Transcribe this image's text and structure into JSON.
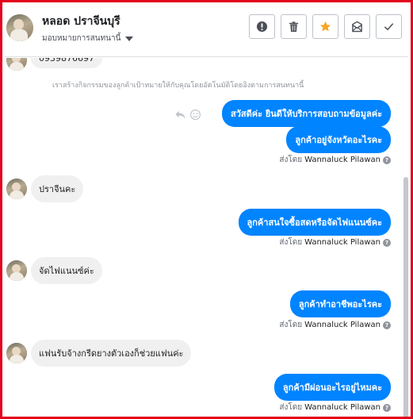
{
  "header": {
    "contact_name": "หลอด ปราจีนบุรี",
    "assign_label": "มอบหมายการสนทนานี้"
  },
  "actions": [
    {
      "name": "alert-button",
      "icon": "exclamation-icon"
    },
    {
      "name": "delete-button",
      "icon": "trash-icon"
    },
    {
      "name": "star-button",
      "icon": "star-icon"
    },
    {
      "name": "mark-unread-button",
      "icon": "envelope-icon"
    },
    {
      "name": "done-button",
      "icon": "check-icon"
    }
  ],
  "colors": {
    "accent": "#0084ff",
    "star": "#f5a623",
    "frame": "#e4001b"
  },
  "conversation": {
    "partial_phone": "0939876697",
    "system_note": "เราสร้างกิจกรรมของลูกค้าเป้าหมายให้กับคุณโดยอัตโนมัติโดยอิงตามการสนทนานี้",
    "sent_by_prefix": "ส่งโดย",
    "sender": "Wannaluck Pilawan",
    "outgoing": {
      "m1": "สวัสดีค่ะ  ยินดีให้บริการสอบถามข้อมูลค่ะ",
      "m2": "ลูกค้าอยู่จังหวัดอะไรคะ",
      "m3": "ลูกค้าสนใจซื้อสดหรือจัดไฟแนนซ์คะ",
      "m4": "ลูกค้าทำอาชีพอะไรคะ",
      "m5": "ลูกค้ามีผ่อนอะไรอยู่ไหมคะ"
    },
    "incoming": {
      "i1": "ปราจีนคะ",
      "i2": "จัดไฟแนนซ์ค่ะ",
      "i3": "แฟนรับจ้างกรีดยางตัวเองก็ช่วยแฟนค่ะ"
    }
  }
}
